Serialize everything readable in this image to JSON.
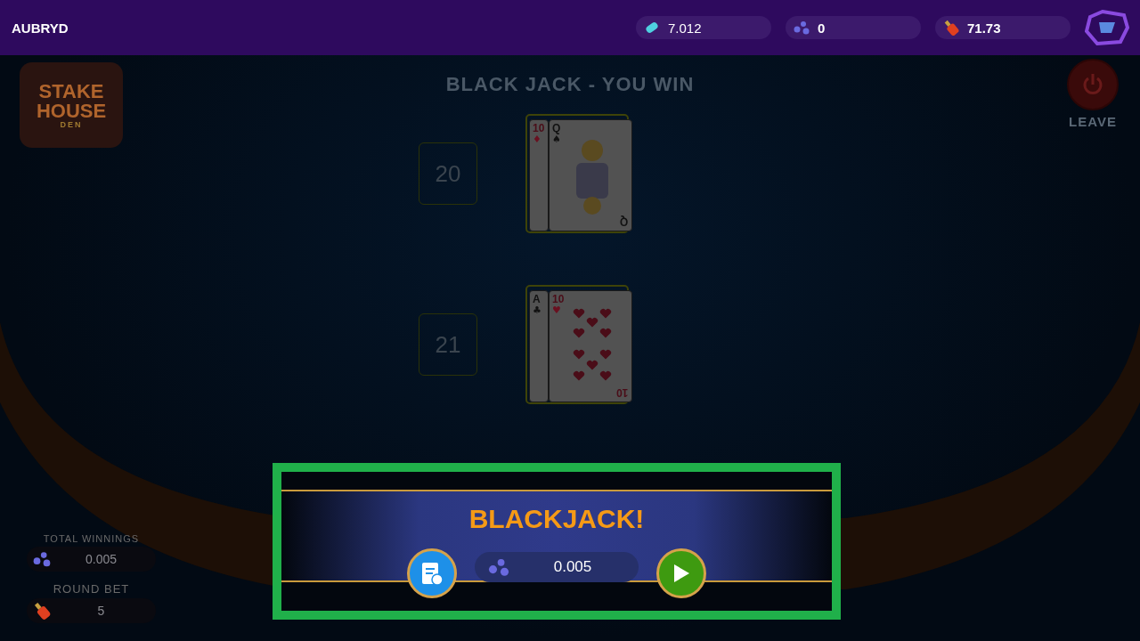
{
  "top_bar": {
    "username": "AUBRYD",
    "balances": [
      {
        "kind": "capsule",
        "value": "7.012",
        "bold": false
      },
      {
        "kind": "molecule",
        "value": "0",
        "bold": true
      },
      {
        "kind": "bottle",
        "value": "71.73",
        "bold": true
      }
    ]
  },
  "logo": {
    "lines": [
      "STAKE",
      "HOUSE",
      "DEN"
    ]
  },
  "title": "BLACK JACK - YOU WIN",
  "leave": {
    "label": "LEAVE"
  },
  "hands": [
    {
      "score": "20",
      "cards": [
        {
          "rank": "10",
          "suit": "♦"
        },
        {
          "rank": "Q",
          "suit": "♠",
          "kind": "court",
          "bottom_rank": "Q"
        }
      ]
    },
    {
      "score": "21",
      "cards": [
        {
          "rank": "A",
          "suit": "♣"
        },
        {
          "rank": "10",
          "suit": "♥",
          "kind": "pips",
          "bottom_rank": "10"
        }
      ]
    }
  ],
  "stats": [
    {
      "kind": "molecule",
      "label": "TOTAL WINNINGS",
      "value": "0.005"
    },
    {
      "kind": "bottle",
      "label": "ROUND BET",
      "value": "5"
    }
  ],
  "result": {
    "title": "BLACKJACK!",
    "amount": "0.005",
    "highlighted": true
  }
}
